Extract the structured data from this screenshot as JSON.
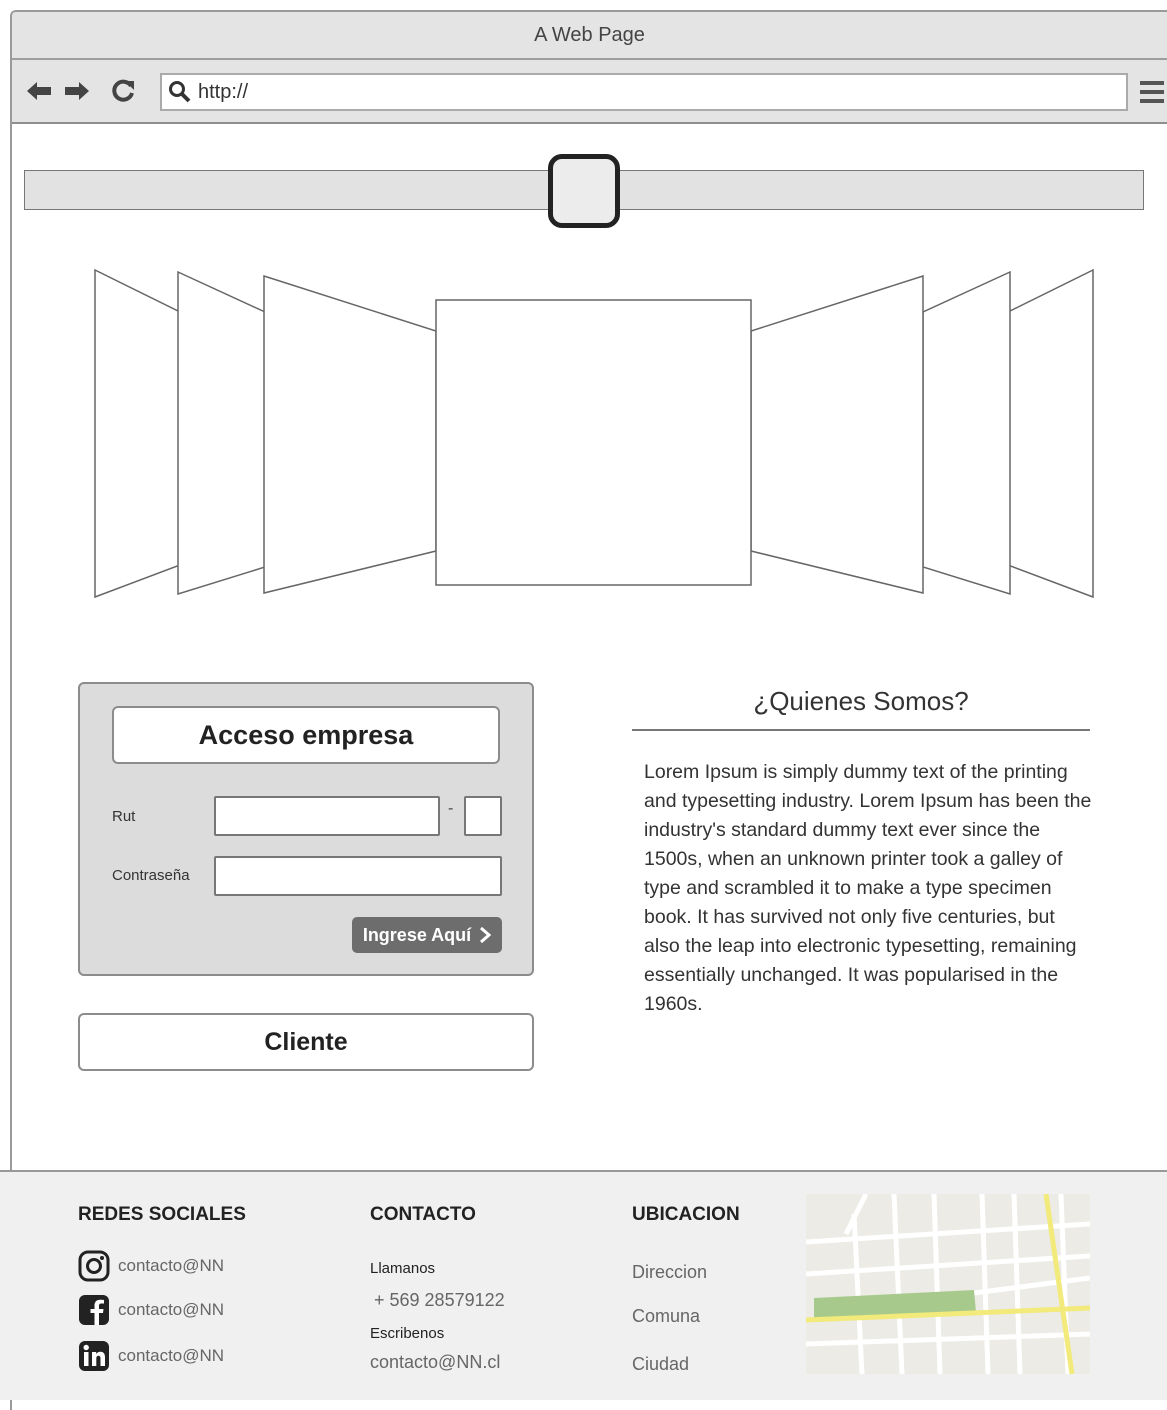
{
  "window": {
    "title": "A Web Page"
  },
  "browser": {
    "url_value": "http://",
    "icons": [
      "back-arrow-icon",
      "forward-arrow-icon",
      "reload-icon",
      "search-icon",
      "hamburger-menu-icon"
    ]
  },
  "slider": {
    "value": 0.5
  },
  "login": {
    "title": "Acceso empresa",
    "rut_label": "Rut",
    "rut_separator": "-",
    "password_label": "Contraseña",
    "submit_label": "Ingrese Aquí"
  },
  "cliente": {
    "label": "Cliente"
  },
  "about": {
    "title": "¿Quienes Somos?",
    "text": "Lorem Ipsum is simply dummy text of the printing and typesetting industry. Lorem Ipsum has been the industry's standard dummy text ever since the 1500s, when an unknown printer took a galley of type and scrambled it to make a type specimen book. It has survived not only five centuries, but also the leap into electronic typesetting, remaining essentially unchanged. It was popularised in the 1960s."
  },
  "footer": {
    "social": {
      "heading": "REDES SOCIALES",
      "items": [
        {
          "icon": "instagram-icon",
          "text": "contacto@NN"
        },
        {
          "icon": "facebook-icon",
          "text": "contacto@NN"
        },
        {
          "icon": "linkedin-icon",
          "text": "contacto@NN"
        }
      ]
    },
    "contact": {
      "heading": "CONTACTO",
      "call_label": "Llamanos",
      "phone": "+ 569 28579122",
      "write_label": "Escribenos",
      "email": "contacto@NN.cl"
    },
    "location": {
      "heading": "UBICACION",
      "address": "Direccion",
      "comuna": "Comuna",
      "city": "Ciudad"
    }
  }
}
